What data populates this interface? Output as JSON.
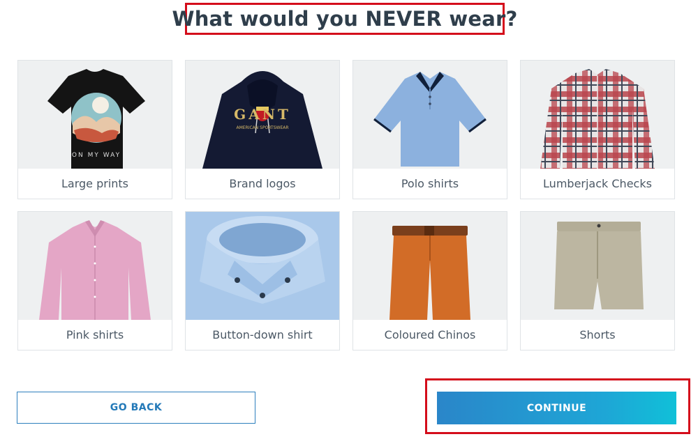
{
  "title": "What would you NEVER wear?",
  "items": [
    {
      "label": "Large prints",
      "icon": "tshirt-print-image",
      "print_text": "ON MY WAY"
    },
    {
      "label": "Brand logos",
      "icon": "hoodie-logo-image",
      "logo_text": "GANT",
      "logo_sub": "AMERICAN SPORTSWEAR"
    },
    {
      "label": "Polo shirts",
      "icon": "polo-shirt-image"
    },
    {
      "label": "Lumberjack Checks",
      "icon": "check-shirt-image"
    },
    {
      "label": "Pink shirts",
      "icon": "pink-shirt-image"
    },
    {
      "label": "Button-down shirt",
      "icon": "button-down-collar-image"
    },
    {
      "label": "Coloured Chinos",
      "icon": "chinos-image"
    },
    {
      "label": "Shorts",
      "icon": "shorts-image"
    }
  ],
  "buttons": {
    "back": "GO BACK",
    "continue": "CONTINUE"
  },
  "colors": {
    "highlight": "#d40d1b",
    "primary": "#2a86c9",
    "primary_end": "#10c0d8",
    "text": "#2f3e4b"
  }
}
